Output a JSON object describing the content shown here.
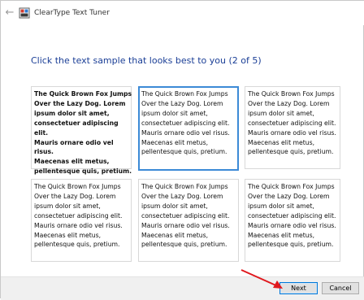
{
  "window": {
    "title": "ClearType Text Tuner",
    "back_icon": "back-arrow-icon",
    "app_icon": "cleartype-app-icon"
  },
  "main": {
    "instruction": "Click the text sample that looks best to you (2 of 5)",
    "selected_index": 1,
    "samples": [
      {
        "text": "The Quick Brown Fox Jumps\nOver the Lazy Dog. Lorem\nipsum dolor sit amet,\nconsectetuer adipiscing elit.\nMauris ornare odio vel risus.\nMaecenas elit metus,\npellentesque quis, pretium."
      },
      {
        "text": "The Quick Brown Fox Jumps\nOver the Lazy Dog. Lorem\nipsum dolor sit amet,\nconsectetuer adipiscing elit.\nMauris ornare odio vel risus.\nMaecenas elit metus,\npellentesque quis, pretium."
      },
      {
        "text": "The Quick Brown Fox Jumps\nOver the Lazy Dog. Lorem\nipsum dolor sit amet,\nconsectetuer adipiscing elit.\nMauris ornare odio vel risus.\nMaecenas elit metus,\npellentesque quis, pretium."
      },
      {
        "text": "The Quick Brown Fox Jumps\nOver the Lazy Dog. Lorem\nipsum dolor sit amet,\nconsectetuer adipiscing elit.\nMauris ornare odio vel risus.\nMaecenas elit metus,\npellentesque quis, pretium."
      },
      {
        "text": "The Quick Brown Fox Jumps\nOver the Lazy Dog. Lorem\nipsum dolor sit amet,\nconsectetuer adipiscing elit.\nMauris ornare odio vel risus.\nMaecenas elit metus,\npellentesque quis, pretium."
      },
      {
        "text": "The Quick Brown Fox Jumps\nOver the Lazy Dog. Lorem\nipsum dolor sit amet,\nconsectetuer adipiscing elit.\nMauris ornare odio vel risus.\nMaecenas elit metus,\npellentesque quis, pretium."
      }
    ]
  },
  "footer": {
    "next_label": "Next",
    "cancel_label": "Cancel"
  },
  "colors": {
    "heading": "#1a3e96",
    "selection_border": "#3c8ad6",
    "annotation_arrow": "#e0191e"
  }
}
